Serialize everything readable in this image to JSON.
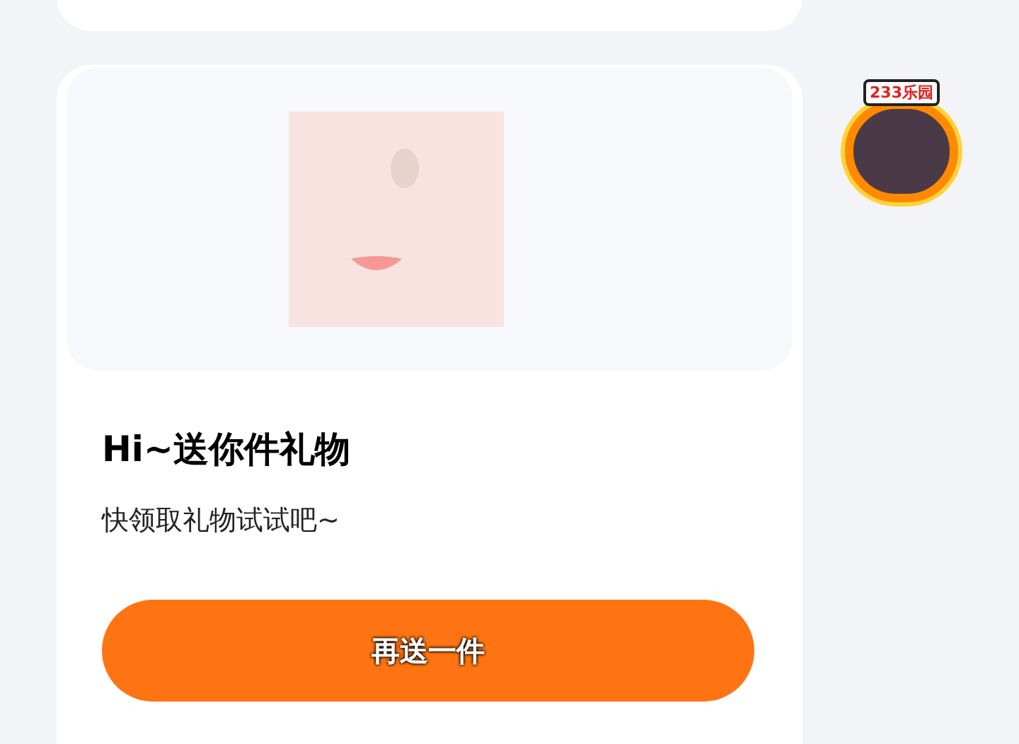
{
  "card": {
    "title": "Hi~送你件礼物",
    "subtitle": "快领取礼物试试吧~",
    "button": "再送一件"
  },
  "badge": {
    "label": "233乐园"
  }
}
